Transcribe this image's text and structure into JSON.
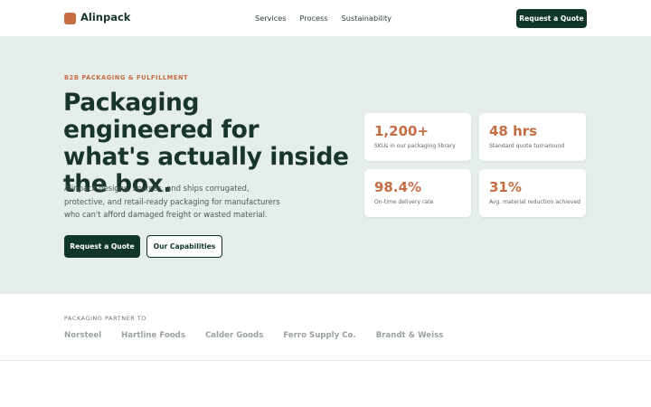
{
  "header": {
    "brand": "Alinpack",
    "nav": [
      {
        "label": "Services"
      },
      {
        "label": "Process"
      },
      {
        "label": "Sustainability"
      }
    ],
    "cta_label": "Request a Quote"
  },
  "hero": {
    "eyebrow": "B2B PACKAGING & FULFILLMENT",
    "headline": "Packaging engineered for what's actually inside the box.",
    "subtext": "Alinpack designs, sources, and ships corrugated, protective, and retail-ready packaging for manufacturers who can't afford damaged freight or wasted material.",
    "primary_button": "Request a Quote",
    "secondary_button": "Our Capabilities"
  },
  "stats": [
    {
      "value": "1,200+",
      "label": "SKUs in our packaging library"
    },
    {
      "value": "48 hrs",
      "label": "Standard quote turnaround"
    },
    {
      "value": "98.4%",
      "label": "On-time delivery rate"
    },
    {
      "value": "31%",
      "label": "Avg. material reduction achieved"
    }
  ],
  "partners": {
    "label": "PACKAGING PARTNER TO",
    "names": [
      "Norsteel",
      "Hartline Foods",
      "Calder Goods",
      "Ferro Supply Co.",
      "Brandt & Weiss"
    ]
  },
  "colors": {
    "brand_dark": "#10362a",
    "accent": "#c56e44",
    "hero_bg": "#e6eeea"
  }
}
